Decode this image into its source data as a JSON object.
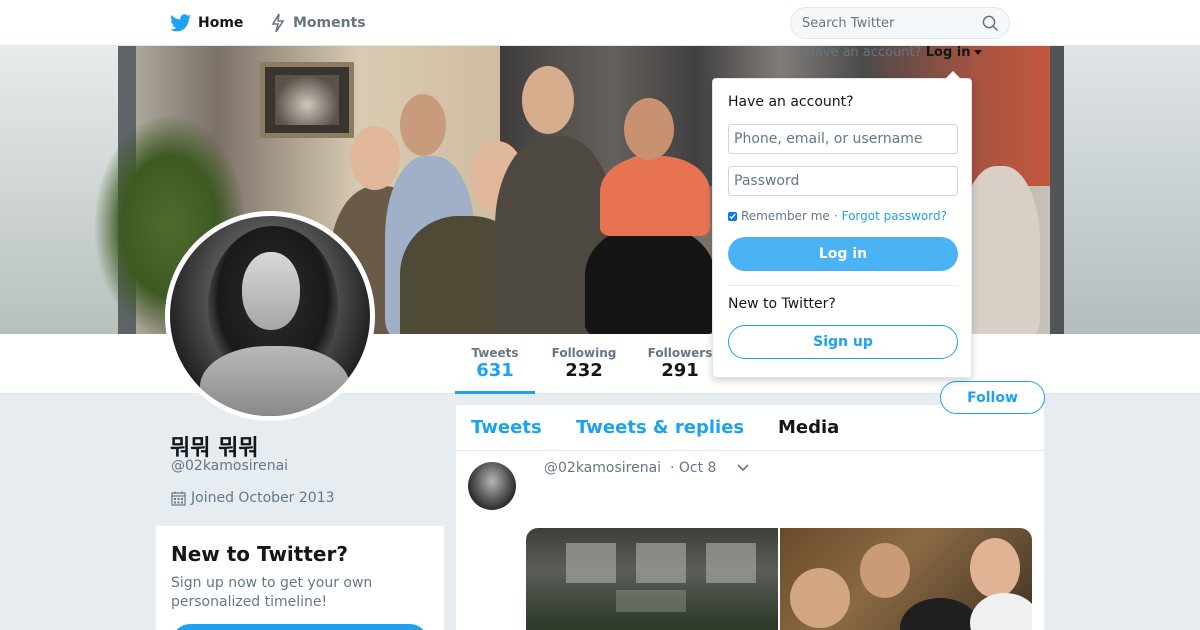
{
  "nav": {
    "home_label": "Home",
    "moments_label": "Moments",
    "search_placeholder": "Search Twitter"
  },
  "login_menu": {
    "prompt": "Have an account?",
    "trigger": "Log in",
    "title": "Have an account?",
    "username_placeholder": "Phone, email, or username",
    "password_placeholder": "Password",
    "remember_label": "Remember me",
    "separator": "·",
    "forgot_label": "Forgot password?",
    "login_button": "Log in",
    "new_prompt": "New to Twitter?",
    "signup_button": "Sign up"
  },
  "profile": {
    "name": "뭐뭐 뭐뭐",
    "handle": "@02kamosirenai",
    "joined": "Joined October 2013",
    "follow_button": "Follow",
    "stats": [
      {
        "label": "Tweets",
        "value": "631"
      },
      {
        "label": "Following",
        "value": "232"
      },
      {
        "label": "Followers",
        "value": "291"
      }
    ]
  },
  "signup_card": {
    "title": "New to Twitter?",
    "text": "Sign up now to get your own personalized timeline!"
  },
  "timeline": {
    "tabs": [
      "Tweets",
      "Tweets & replies",
      "Media"
    ],
    "active_tab": "Media",
    "tweet": {
      "handle": "@02kamosirenai",
      "time": "· Oct 8"
    }
  },
  "colors": {
    "accent": "#1da1f2",
    "background": "#e6ecf0",
    "text_secondary": "#657786"
  },
  "icons": [
    "twitter-bird-icon",
    "lightning-icon",
    "search-icon",
    "calendar-icon",
    "chevron-down-icon"
  ]
}
